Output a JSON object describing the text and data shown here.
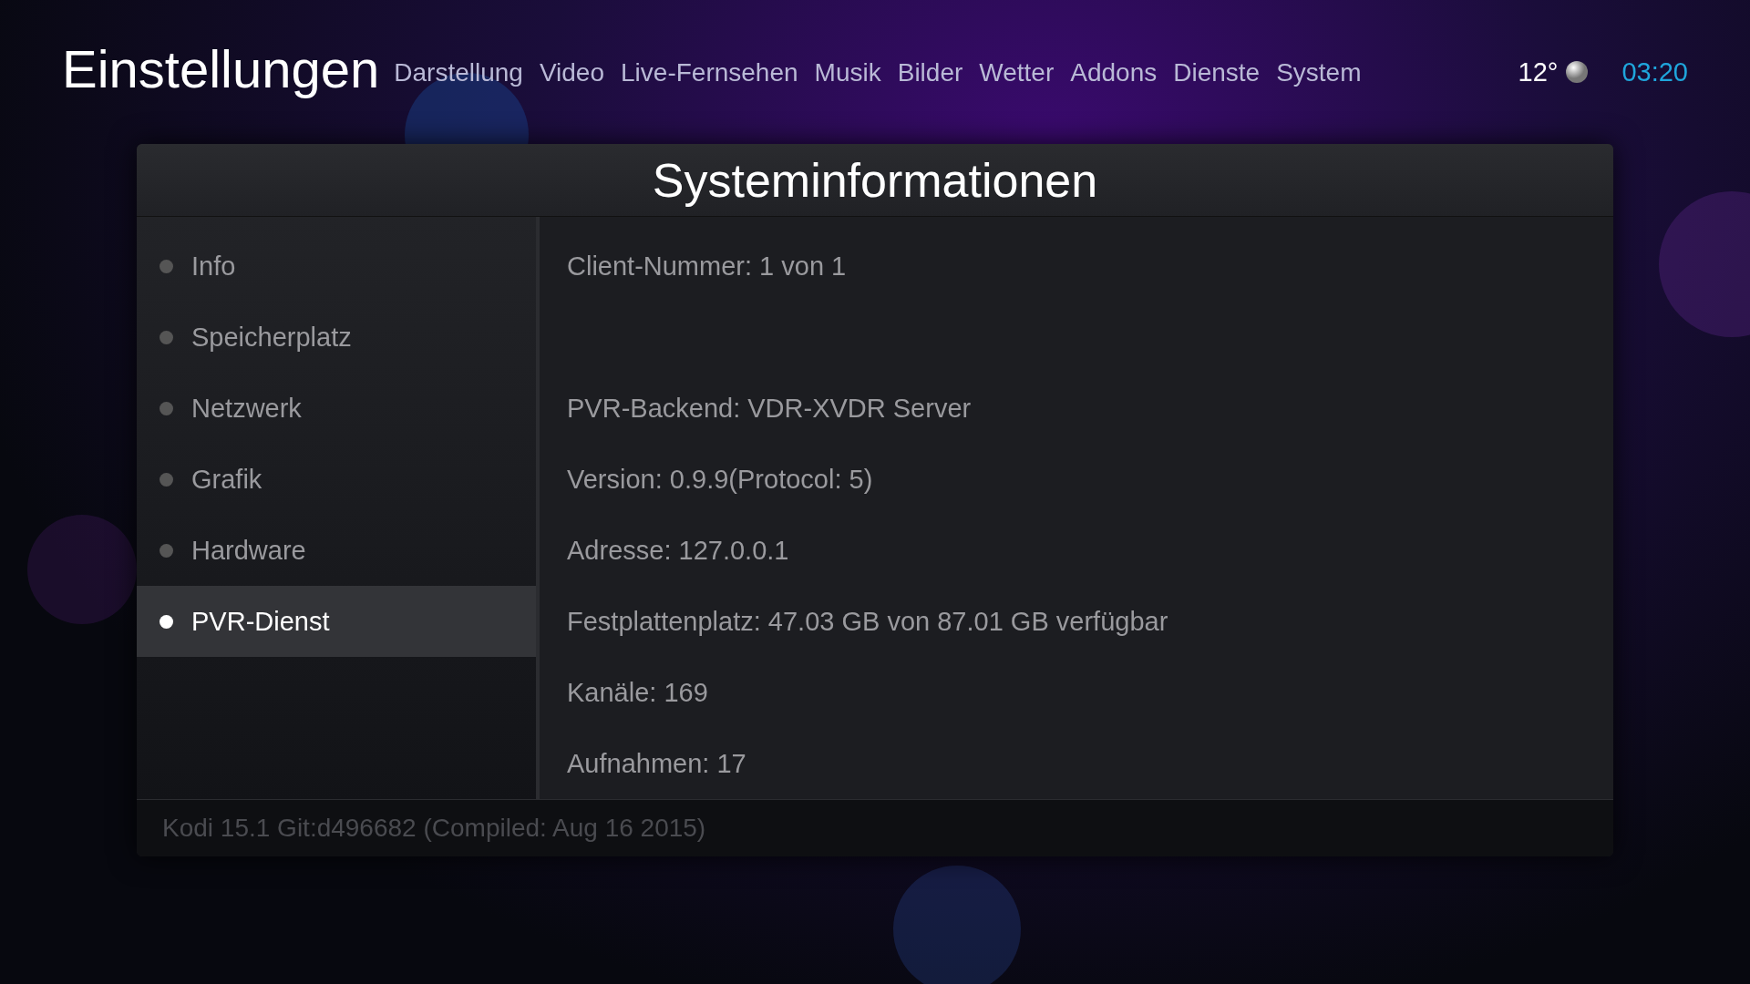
{
  "header": {
    "title": "Einstellungen",
    "nav": [
      "Darstellung",
      "Video",
      "Live-Fernsehen",
      "Musik",
      "Bilder",
      "Wetter",
      "Addons",
      "Dienste",
      "System"
    ],
    "temperature": "12°",
    "time": "03:20"
  },
  "panel": {
    "title": "Systeminformationen",
    "sidebar": [
      {
        "label": "Info",
        "selected": false
      },
      {
        "label": "Speicherplatz",
        "selected": false
      },
      {
        "label": "Netzwerk",
        "selected": false
      },
      {
        "label": "Grafik",
        "selected": false
      },
      {
        "label": "Hardware",
        "selected": false
      },
      {
        "label": "PVR-Dienst",
        "selected": true
      }
    ],
    "info_lines": [
      {
        "text": "Client-Nummer: 1 von 1",
        "spacer_after": true
      },
      {
        "text": "PVR-Backend: VDR-XVDR Server"
      },
      {
        "text": "Version: 0.9.9(Protocol: 5)"
      },
      {
        "text": "Adresse: 127.0.0.1"
      },
      {
        "text": "Festplattenplatz: 47.03 GB von 87.01 GB verfügbar"
      },
      {
        "text": "Kanäle: 169"
      },
      {
        "text": "Aufnahmen: 17"
      }
    ],
    "footer": "Kodi 15.1 Git:d496682 (Compiled: Aug 16 2015)"
  }
}
